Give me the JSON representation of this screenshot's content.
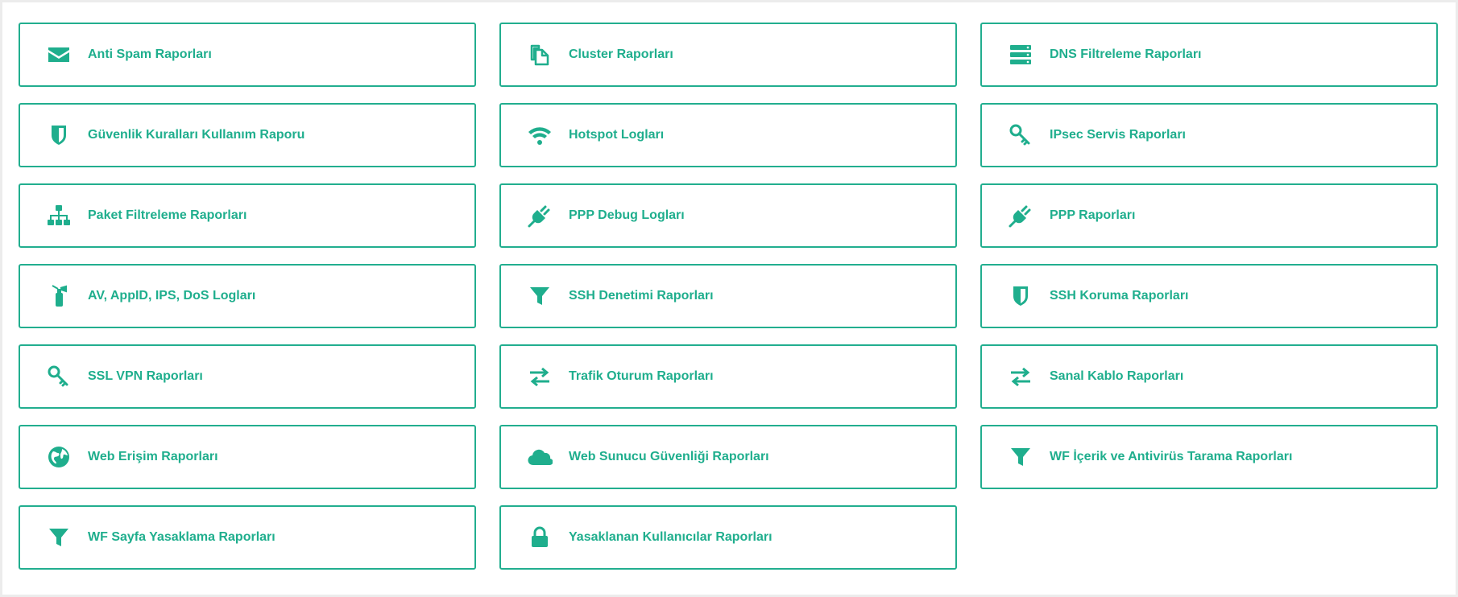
{
  "accent_color": "#1fae8d",
  "border_color": "#22ae8f",
  "reports": [
    {
      "label": "Anti Spam Raporları",
      "icon": "envelope-icon"
    },
    {
      "label": "Cluster Raporları",
      "icon": "copy-icon"
    },
    {
      "label": "DNS Filtreleme Raporları",
      "icon": "server-icon"
    },
    {
      "label": "Güvenlik Kuralları Kullanım Raporu",
      "icon": "shield-icon"
    },
    {
      "label": "Hotspot Logları",
      "icon": "wifi-icon"
    },
    {
      "label": "IPsec Servis Raporları",
      "icon": "key-icon"
    },
    {
      "label": "Paket Filtreleme Raporları",
      "icon": "sitemap-icon"
    },
    {
      "label": "PPP Debug Logları",
      "icon": "plug-icon"
    },
    {
      "label": "PPP Raporları",
      "icon": "plug-icon"
    },
    {
      "label": "AV, AppID, IPS, DoS Logları",
      "icon": "fire-extinguisher-icon"
    },
    {
      "label": "SSH Denetimi Raporları",
      "icon": "filter-icon"
    },
    {
      "label": "SSH Koruma Raporları",
      "icon": "shield-icon"
    },
    {
      "label": "SSL VPN Raporları",
      "icon": "key-icon"
    },
    {
      "label": "Trafik Oturum Raporları",
      "icon": "exchange-icon"
    },
    {
      "label": "Sanal Kablo Raporları",
      "icon": "exchange-icon"
    },
    {
      "label": "Web Erişim Raporları",
      "icon": "globe-icon"
    },
    {
      "label": "Web Sunucu Güvenliği Raporları",
      "icon": "cloud-icon"
    },
    {
      "label": "WF İçerik ve Antivirüs Tarama Raporları",
      "icon": "filter-icon"
    },
    {
      "label": "WF Sayfa Yasaklama Raporları",
      "icon": "filter-icon"
    },
    {
      "label": "Yasaklanan Kullanıcılar Raporları",
      "icon": "lock-icon"
    }
  ]
}
